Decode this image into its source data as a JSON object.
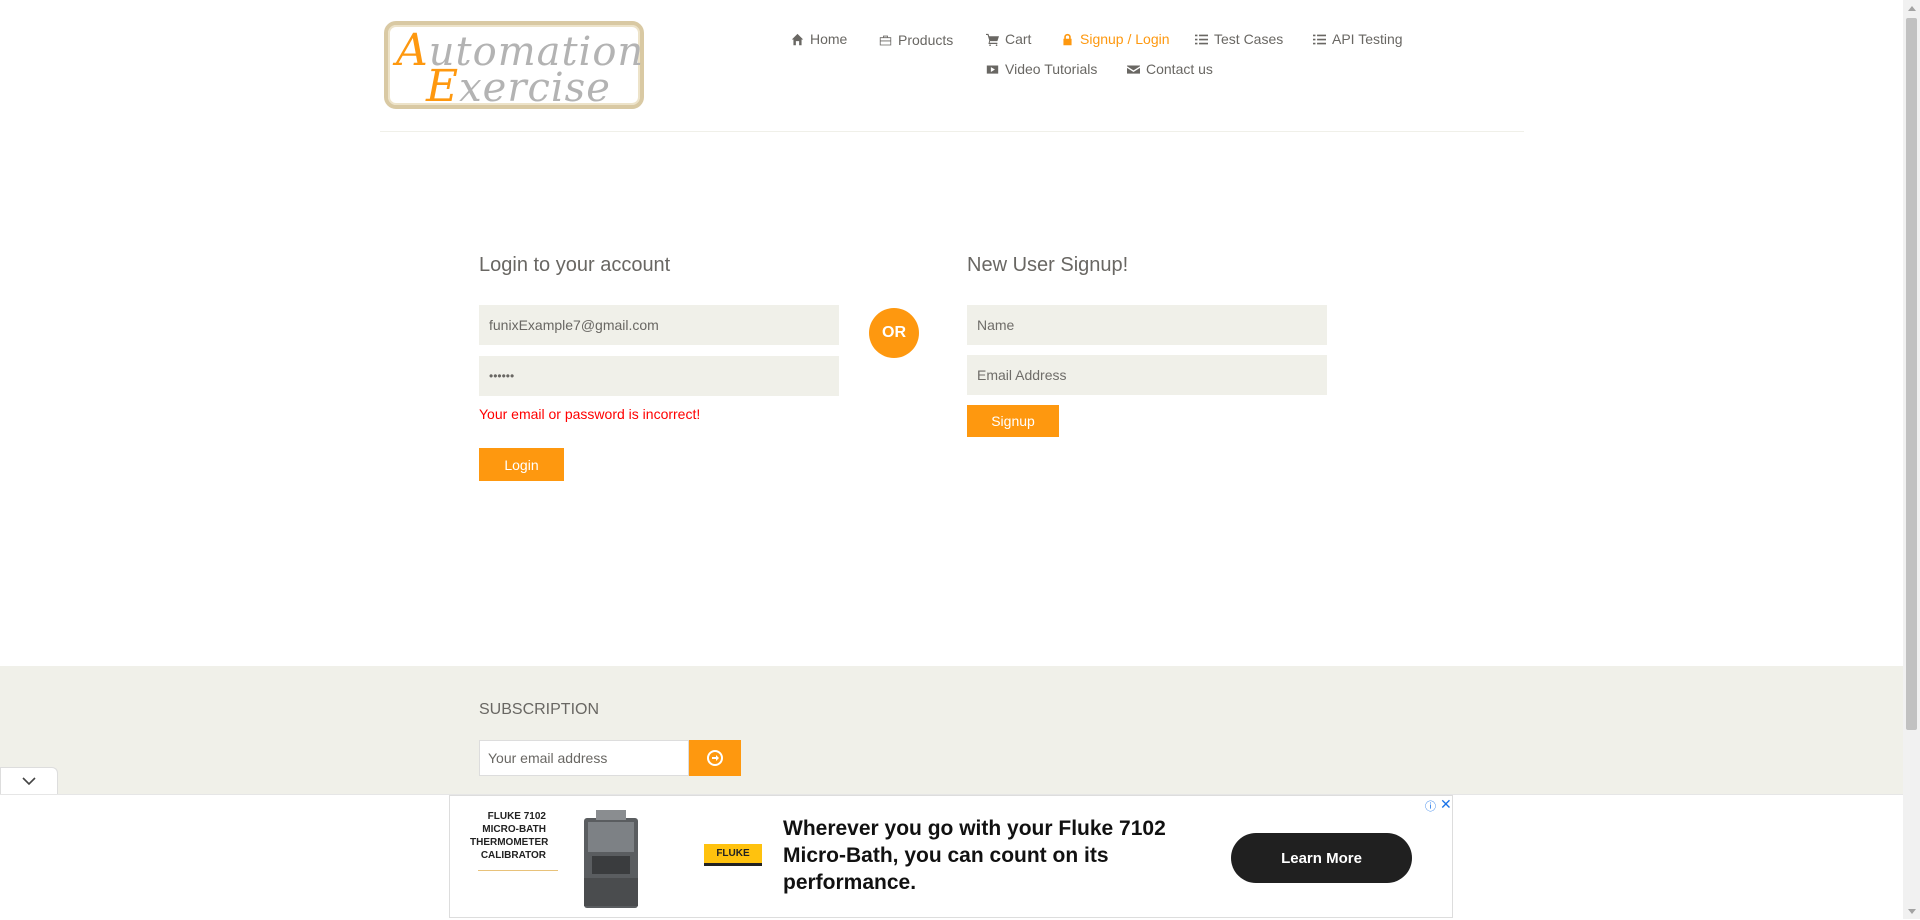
{
  "brand": {
    "logo_line1_cap": "A",
    "logo_line1_rest": "utomation",
    "logo_line2_cap": "E",
    "logo_line2_rest": "xercise"
  },
  "nav": {
    "home": "Home",
    "products": "Products",
    "cart": "Cart",
    "signup_login": "Signup / Login",
    "test_cases": "Test Cases",
    "api_testing": "API Testing",
    "video_tutorials": "Video Tutorials",
    "contact_us": "Contact us",
    "active": "signup_login"
  },
  "login": {
    "title": "Login to your account",
    "email_value": "funixExample7@gmail.com",
    "password_value": "••••••",
    "error": "Your email or password is incorrect!",
    "button": "Login"
  },
  "or_label": "OR",
  "signup": {
    "title": "New User Signup!",
    "name_placeholder": "Name",
    "email_placeholder": "Email Address",
    "button": "Signup"
  },
  "footer": {
    "subscription_title": "SUBSCRIPTION",
    "subscription_placeholder": "Your email address"
  },
  "ad": {
    "product_name": "FLUKE 7102 MICRO-BATH THERMOMETER CALIBRATOR",
    "brand": "FLUKE",
    "headline": "Wherever you go with your Fluke 7102 Micro-Bath, you can count on its performance.",
    "cta": "Learn More",
    "info": "ⓘ",
    "close": "✕"
  },
  "colors": {
    "accent": "#fe980f",
    "field_bg": "#f0f0e9",
    "text": "#696763",
    "error": "#ff0000"
  }
}
